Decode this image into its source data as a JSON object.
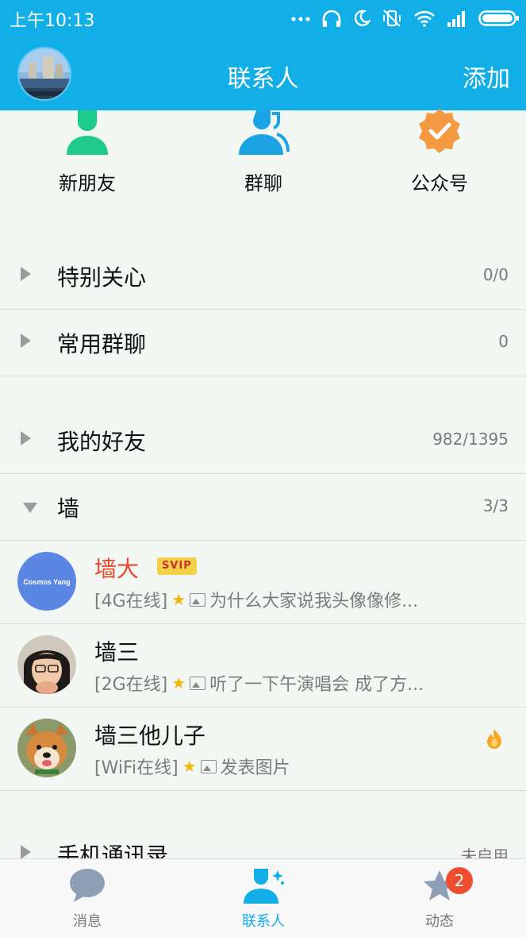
{
  "status_bar": {
    "time": "上午10:13"
  },
  "header": {
    "title": "联系人",
    "add_label": "添加"
  },
  "quick_entries": [
    {
      "label": "新朋友"
    },
    {
      "label": "群聊"
    },
    {
      "label": "公众号"
    }
  ],
  "groups": {
    "special": {
      "name": "特别关心",
      "count": "0/0"
    },
    "common_chats": {
      "name": "常用群聊",
      "count": "0"
    },
    "friends": {
      "name": "我的好友",
      "count": "982/1395"
    },
    "wall": {
      "name": "墙",
      "count": "3/3"
    },
    "phone": {
      "name": "手机通讯录",
      "count": "未启用"
    }
  },
  "contacts": [
    {
      "name": "墙大",
      "badge": "SVIP",
      "avatar_text": "Cosmos Yang",
      "network": "[4G在线]",
      "message": "为什么大家说我头像像修..."
    },
    {
      "name": "墙三",
      "network": "[2G在线]",
      "message": "听了一下午演唱会 成了方..."
    },
    {
      "name": "墙三他儿子",
      "network": "[WiFi在线]",
      "message": "发表图片"
    }
  ],
  "tabs": [
    {
      "label": "消息"
    },
    {
      "label": "联系人"
    },
    {
      "label": "动态",
      "badge": "2"
    }
  ],
  "colors": {
    "accent": "#12aee8",
    "vip_name": "#e8472f",
    "badge_red": "#ee4d2f",
    "star": "#f1b70e"
  }
}
